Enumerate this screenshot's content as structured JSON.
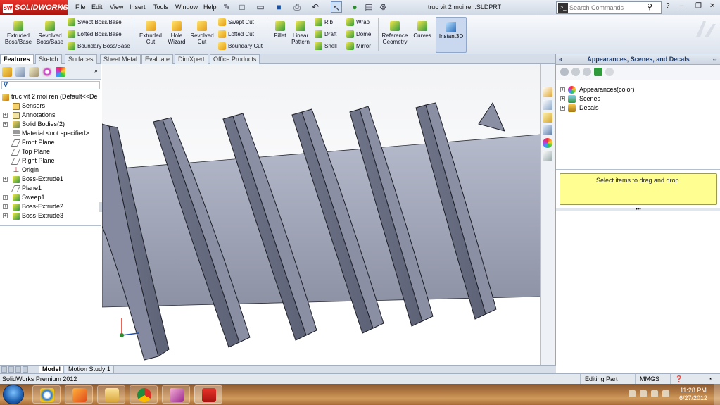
{
  "app": {
    "brand": "SOLIDWORKS",
    "brand_badge": "SW",
    "document_title": "truc vit 2 moi ren.SLDPRT"
  },
  "menu": [
    "File",
    "Edit",
    "View",
    "Insert",
    "Tools",
    "Window",
    "Help"
  ],
  "search": {
    "placeholder": "Search Commands"
  },
  "command_manager": {
    "extruded_boss": "Extruded Boss/Base",
    "revolved_boss": "Revolved Boss/Base",
    "swept_boss": "Swept Boss/Base",
    "lofted_boss": "Lofted Boss/Base",
    "boundary_boss": "Boundary Boss/Base",
    "extruded_cut": "Extruded Cut",
    "hole_wizard": "Hole Wizard",
    "revolved_cut": "Revolved Cut",
    "swept_cut": "Swept Cut",
    "lofted_cut": "Lofted Cut",
    "boundary_cut": "Boundary Cut",
    "fillet": "Fillet",
    "linear_pattern": "Linear Pattern",
    "rib": "Rib",
    "draft": "Draft",
    "shell": "Shell",
    "wrap": "Wrap",
    "dome": "Dome",
    "mirror": "Mirror",
    "reference_geometry": "Reference Geometry",
    "curves": "Curves",
    "instant3d": "Instant3D"
  },
  "tabs": [
    "Features",
    "Sketch",
    "Surfaces",
    "Sheet Metal",
    "Evaluate",
    "DimXpert",
    "Office Products"
  ],
  "tree": {
    "root": "truc vit 2 moi ren  (Default<<De",
    "items": [
      "Sensors",
      "Annotations",
      "Solid Bodies(2)",
      "Material <not specified>",
      "Front Plane",
      "Top Plane",
      "Right Plane",
      "Origin",
      "Boss-Extrude1",
      "Plane1",
      "Sweep1",
      "Boss-Extrude2",
      "Boss-Extrude3"
    ]
  },
  "task_pane": {
    "title": "Appearances, Scenes, and Decals",
    "items": [
      "Appearances(color)",
      "Scenes",
      "Decals"
    ],
    "message": "Select items to drag and drop."
  },
  "bottom_tabs": [
    "Model",
    "Motion Study 1"
  ],
  "status": {
    "product": "SolidWorks Premium 2012",
    "mode": "Editing Part",
    "units": "MMGS"
  },
  "clock": {
    "time": "11:28 PM",
    "date": "6/27/2012"
  },
  "colors": {
    "accent_red": "#c8231b",
    "part_gray": "#a7acbd",
    "highlight_yellow": "#fefe91"
  }
}
